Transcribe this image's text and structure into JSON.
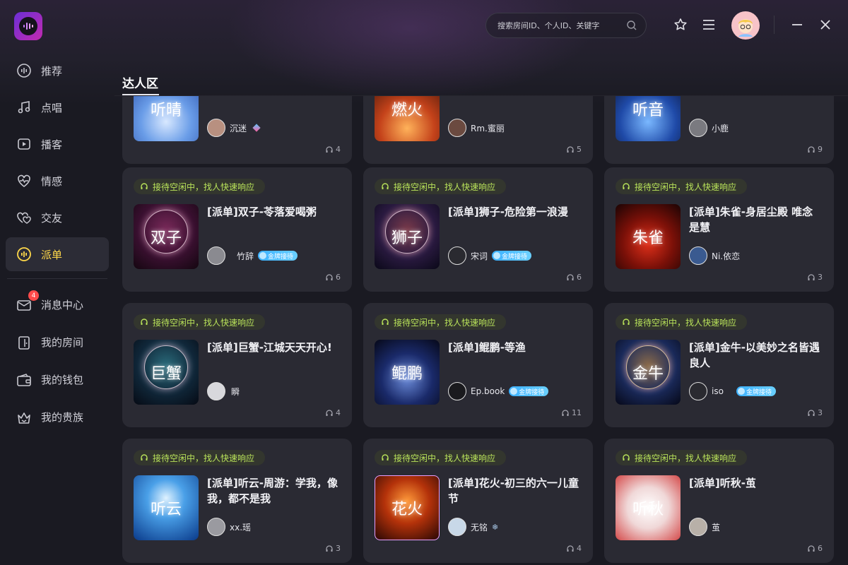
{
  "app": {
    "section_title": "达人区"
  },
  "search": {
    "placeholder": "搜索房间ID、个人ID、关键字"
  },
  "sidebar": {
    "items": [
      {
        "label": "推荐",
        "icon": "wave-icon"
      },
      {
        "label": "点唱",
        "icon": "music-note-icon"
      },
      {
        "label": "播客",
        "icon": "play-screen-icon"
      },
      {
        "label": "情感",
        "icon": "heart-pulse-icon"
      },
      {
        "label": "交友",
        "icon": "hearts-icon"
      },
      {
        "label": "派单",
        "icon": "wave-circle-icon",
        "active": true
      }
    ],
    "personal": [
      {
        "label": "消息中心",
        "icon": "mail-icon",
        "badge": "4"
      },
      {
        "label": "我的房间",
        "icon": "door-icon"
      },
      {
        "label": "我的钱包",
        "icon": "wallet-icon"
      },
      {
        "label": "我的贵族",
        "icon": "crown-icon"
      }
    ]
  },
  "colors": {
    "accent": "#ffd84a",
    "tag_text": "#b9e35a",
    "card_bg": "#2a2a33",
    "bg": "#1a1a22"
  },
  "cards": [
    {
      "tag": "",
      "title": "",
      "cover": "听晴",
      "host": "沉迷",
      "medal": "",
      "count": "4"
    },
    {
      "tag": "",
      "title": "",
      "cover": "燃火",
      "host": "Rm.蜜丽",
      "medal": "",
      "count": "5"
    },
    {
      "tag": "",
      "title": "",
      "cover": "听音",
      "host": "小鹿",
      "medal": "",
      "count": "9"
    },
    {
      "tag": "接待空闲中，找人快速响应",
      "title": "[派单]双子-苓落爱喝粥",
      "cover": "双子",
      "host": "竹辞",
      "medal": "金牌接待",
      "count": "6"
    },
    {
      "tag": "接待空闲中，找人快速响应",
      "title": "[派单]狮子-危险第一浪漫",
      "cover": "狮子",
      "host": "宋词",
      "medal": "金牌接待",
      "count": "6"
    },
    {
      "tag": "接待空闲中，找人快速响应",
      "title": "[派单]朱雀-身居尘殿 唯念是慧",
      "cover": "朱雀",
      "host": "Ni.依恋",
      "medal": "",
      "count": "3"
    },
    {
      "tag": "接待空闲中，找人快速响应",
      "title": "[派单]巨蟹-江城天天开心!",
      "cover": "巨蟹",
      "host": "瞬",
      "medal": "",
      "count": "4"
    },
    {
      "tag": "接待空闲中，找人快速响应",
      "title": "[派单]鲲鹏-等渔",
      "cover": "鲲鹏",
      "host": "Ep.book",
      "medal": "金牌接待",
      "count": "11"
    },
    {
      "tag": "接待空闲中，找人快速响应",
      "title": "[派单]金牛-以美妙之名皆遇良人",
      "cover": "金牛",
      "host": "iso",
      "medal": "金牌接待",
      "count": "3"
    },
    {
      "tag": "接待空闲中，找人快速响应",
      "title": "[派单]听云-周游：学我，像我，都不是我",
      "cover": "听云",
      "host": "xx.瑶",
      "medal": "",
      "count": "3"
    },
    {
      "tag": "接待空闲中，找人快速响应",
      "title": "[派单]花火-初三的六一儿童节",
      "cover": "花火",
      "host": "无铭",
      "medal": "",
      "count": "4"
    },
    {
      "tag": "接待空闲中，找人快速响应",
      "title": "[派单]听秋-茧",
      "cover": "听秋",
      "host": "茧",
      "medal": "",
      "count": "6"
    }
  ]
}
